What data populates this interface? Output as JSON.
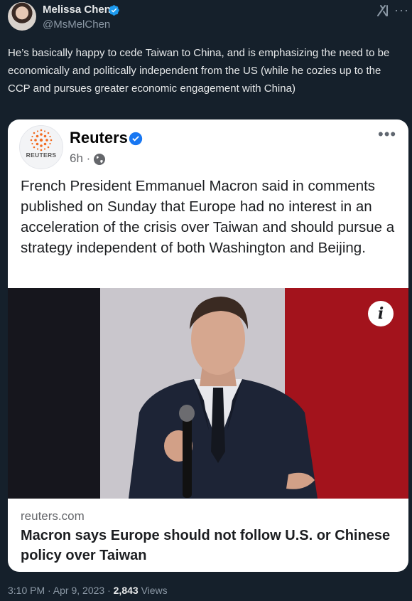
{
  "author": {
    "name": "Melissa Chen",
    "handle": "@MsMelChen"
  },
  "tweet": {
    "lines": [
      "He’s basically happy to cede Taiwan to China, and is emphasizing the need to be",
      "economically and politically independent from the US (while he cozies up to the CCP and pursues greater economic engagement with China)"
    ]
  },
  "card": {
    "logo_text": "REUTERS",
    "source": "Reuters",
    "time": "6h ·",
    "body": "French President Emmanuel Macron said in comments published on Sunday that Europe had no interest in an acceleration of the crisis over Taiwan and should pursue a strategy independent of both Washington and Beijing.",
    "info_glyph": "i",
    "link_domain": "reuters.com",
    "link_headline": "Macron says Europe should not follow U.S. or Chinese policy over Taiwan"
  },
  "footer": {
    "timestamp": "3:10 PM · Apr 9, 2023 ·",
    "views_count": "2,843",
    "views_label": "Views"
  },
  "icons": {
    "verified": "verified-badge-icon",
    "grok": "grok-icon",
    "more": "more-icon",
    "globe": "globe-icon",
    "info": "info-icon"
  },
  "colors": {
    "background": "#15202b",
    "verified_blue": "#1d9bf0",
    "card_verified_blue": "#1877f2",
    "reuters_orange": "#f26c22"
  }
}
